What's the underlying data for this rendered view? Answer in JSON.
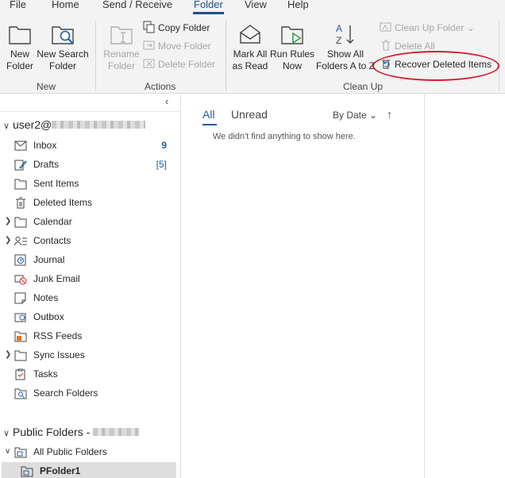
{
  "menu": {
    "tabs": [
      "File",
      "Home",
      "Send / Receive",
      "Folder",
      "View",
      "Help"
    ],
    "active": "Folder"
  },
  "ribbon": {
    "new_group": {
      "label": "New",
      "new_folder": [
        "New",
        "Folder"
      ],
      "new_search_folder": [
        "New Search",
        "Folder"
      ]
    },
    "actions_group": {
      "label": "Actions",
      "rename_folder": [
        "Rename",
        "Folder"
      ],
      "copy_folder": "Copy Folder",
      "move_folder": "Move Folder",
      "delete_folder": "Delete Folder"
    },
    "cleanup_group": {
      "label": "Clean Up",
      "mark_all_read": [
        "Mark All",
        "as Read"
      ],
      "run_rules": [
        "Run Rules",
        "Now"
      ],
      "show_all_folders": [
        "Show All",
        "Folders A to Z"
      ],
      "clean_up_folder": "Clean Up Folder",
      "delete_all": "Delete All",
      "recover_deleted": "Recover Deleted Items"
    }
  },
  "folders": {
    "account": "user2@",
    "items": [
      {
        "name": "Inbox",
        "count": "9"
      },
      {
        "name": "Drafts",
        "count": "[5]"
      },
      {
        "name": "Sent Items",
        "count": ""
      },
      {
        "name": "Deleted Items",
        "count": ""
      },
      {
        "name": "Calendar",
        "count": ""
      },
      {
        "name": "Contacts",
        "count": ""
      },
      {
        "name": "Journal",
        "count": ""
      },
      {
        "name": "Junk Email",
        "count": ""
      },
      {
        "name": "Notes",
        "count": ""
      },
      {
        "name": "Outbox",
        "count": ""
      },
      {
        "name": "RSS Feeds",
        "count": ""
      },
      {
        "name": "Sync Issues",
        "count": ""
      },
      {
        "name": "Tasks",
        "count": ""
      },
      {
        "name": "Search Folders",
        "count": ""
      }
    ],
    "public_header": "Public Folders -",
    "all_public": "All Public Folders",
    "pfolder": "PFolder1"
  },
  "message_list": {
    "filter_all": "All",
    "filter_unread": "Unread",
    "sort": "By Date",
    "empty": "We didn't find anything to show here."
  },
  "colors": {
    "accent": "#1e4e8c",
    "link": "#1e5ba8",
    "highlight_ring": "#d41f2c"
  }
}
